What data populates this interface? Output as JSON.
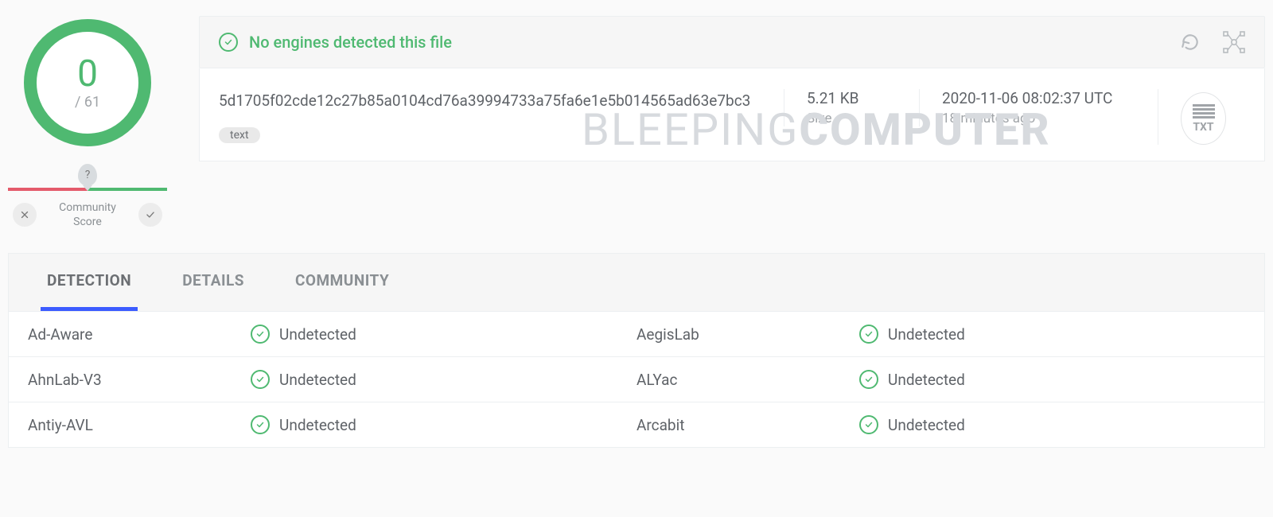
{
  "score": {
    "detections": "0",
    "total": "/ 61"
  },
  "community": {
    "marker": "?",
    "label_line1": "Community",
    "label_line2": "Score"
  },
  "banner": {
    "text": "No engines detected this file"
  },
  "file": {
    "hash": "5d1705f02cde12c27b85a0104cd76a39994733a75fa6e1e5b014565ad63e7bc3",
    "tag": "text",
    "size_value": "5.21 KB",
    "size_label": "Size",
    "time_value": "2020-11-06 08:02:37 UTC",
    "time_label": "18 minutes ago",
    "type_label": "TXT"
  },
  "watermark": {
    "part1": "BLEEPING",
    "part2": "COMPUTER"
  },
  "tabs": {
    "detection": "DETECTION",
    "details": "DETAILS",
    "community": "COMMUNITY"
  },
  "results": [
    {
      "left_engine": "Ad-Aware",
      "left_status": "Undetected",
      "right_engine": "AegisLab",
      "right_status": "Undetected"
    },
    {
      "left_engine": "AhnLab-V3",
      "left_status": "Undetected",
      "right_engine": "ALYac",
      "right_status": "Undetected"
    },
    {
      "left_engine": "Antiy-AVL",
      "left_status": "Undetected",
      "right_engine": "Arcabit",
      "right_status": "Undetected"
    }
  ]
}
